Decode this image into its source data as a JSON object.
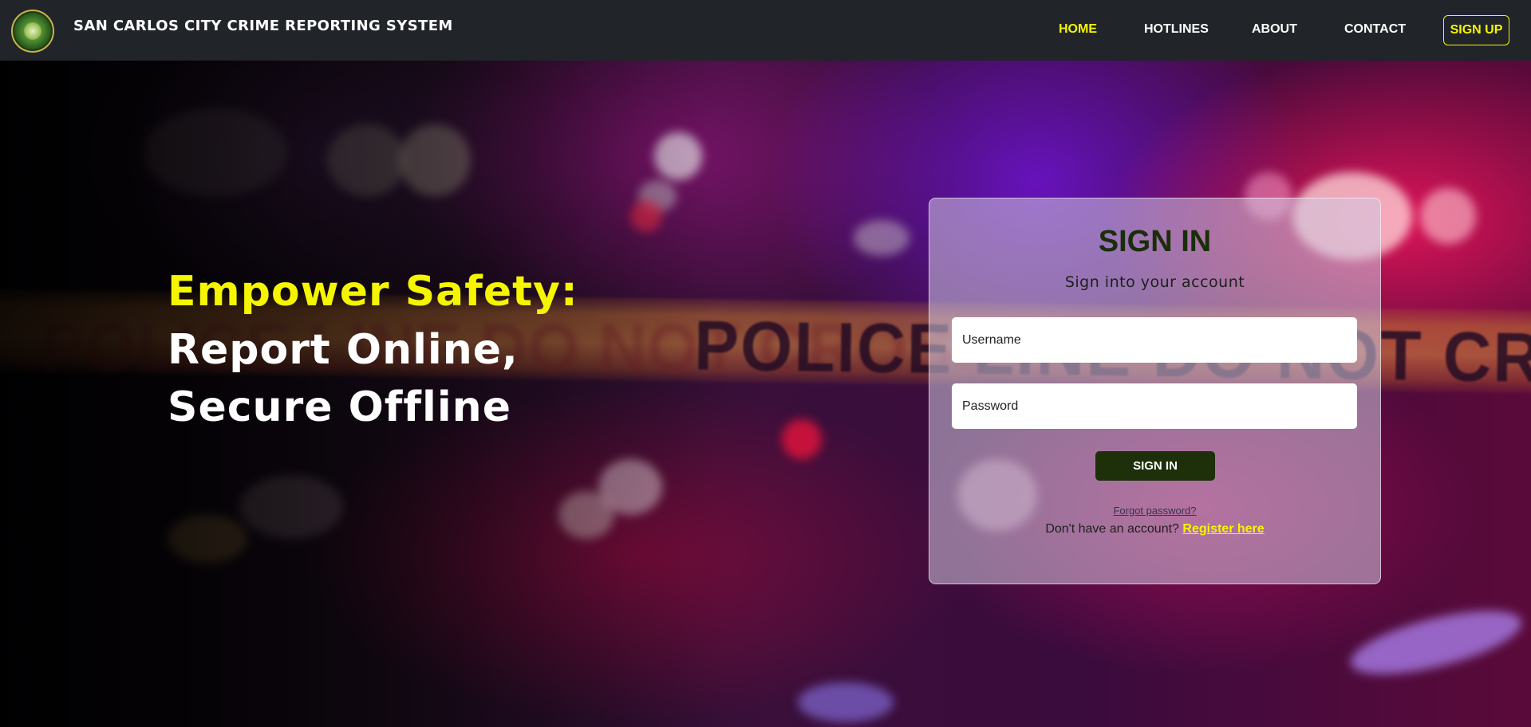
{
  "header": {
    "logo_icon": "city-seal-logo-icon",
    "brand": "SAN CARLOS CITY CRIME REPORTING SYSTEM",
    "nav": [
      {
        "label": "HOME",
        "active": true
      },
      {
        "label": "HOTLINES",
        "active": false
      },
      {
        "label": "ABOUT",
        "active": false
      },
      {
        "label": "CONTACT",
        "active": false
      }
    ],
    "signup_label": "SIGN UP"
  },
  "hero": {
    "line1": "Empower Safety:",
    "line2": "Report Online,",
    "line3": "Secure Offline",
    "background_text": "POLICE LINE DO NOT CROSS"
  },
  "signin_card": {
    "title": "SIGN IN",
    "subtitle": "Sign into your account",
    "username_placeholder": "Username",
    "password_placeholder": "Password",
    "button_label": "SIGN IN",
    "forgot_label": "Forgot password?",
    "register_prompt": "Don't have an account?",
    "register_link": "Register here"
  },
  "colors": {
    "accent_yellow": "#f5f500",
    "navbar_bg": "#212529",
    "button_dark_green": "#1d3009",
    "title_green": "#1a2e0a"
  }
}
